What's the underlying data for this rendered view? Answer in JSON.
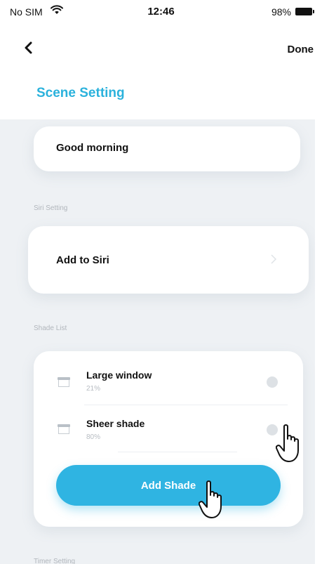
{
  "status_bar": {
    "carrier": "No SIM",
    "time": "12:46",
    "battery": "98%"
  },
  "header": {
    "done_label": "Done",
    "title": "Scene Setting"
  },
  "scene": {
    "name": "Good morning"
  },
  "siri": {
    "section_label": "Siri Setting",
    "add_label": "Add to Siri"
  },
  "shades": {
    "section_label": "Shade List",
    "items": [
      {
        "name": "Large window",
        "percent": "21%"
      },
      {
        "name": "Sheer shade",
        "percent": "80%"
      }
    ],
    "add_button_label": "Add Shade"
  },
  "timer": {
    "section_label": "Timer Setting"
  },
  "colors": {
    "accent": "#2fb4e2",
    "title": "#2bb2dc"
  },
  "icons": [
    "wifi-icon",
    "battery-icon",
    "back-chevron-icon",
    "chevron-right-icon",
    "shade-icon",
    "hand-pointer-icon"
  ]
}
